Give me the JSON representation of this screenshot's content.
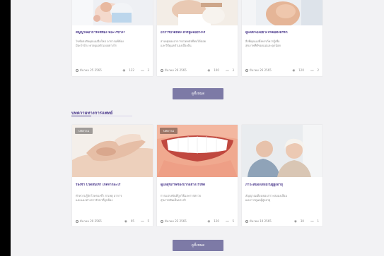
{
  "section": {
    "heading": "บทความทางการแพทย์"
  },
  "buttons": {
    "more_top": "ดูทั้งหมด",
    "more_bottom": "ดูทั้งหมด"
  },
  "top_cards": [
    {
      "title": "สัญญาณอาการแพ้ท้อง มีอะไรบ้าง?",
      "desc1": "ไขข้อสงสัยคุณแม่มือใหม่ อาการแพ้ท้อง",
      "desc2": "มีอะไรบ้าง ควรดูแลตัวเองอย่างไร",
      "date": "มีนาคม 25 2565",
      "views": "122",
      "comments": "3"
    },
    {
      "title": "อาการปวดหลัง ควรดูแลอย่างไร",
      "desc1": "สาเหตุของอาการปวดหลังที่พบได้บ่อย",
      "desc2": "และวิธีดูแลตัวเองเบื้องต้น",
      "date": "มีนาคม 26 2565",
      "views": "100",
      "comments": "3"
    },
    {
      "title": "ดูแลตัวเองอย่างไรเมื่อตั้งครรภ์",
      "desc1": "สิ่งที่คุณแม่ตั้งครรภ์ควรรู้เพื่อ",
      "desc2": "สุขภาพที่ดีของแม่และลูกน้อย",
      "date": "มีนาคม 26 2565",
      "views": "120",
      "comments": "2"
    }
  ],
  "bottom_cards": [
    {
      "tag": "บทความ",
      "title": "รองช้ำ ปวดส้นเท้า เกิดจากอะไร",
      "desc1": "ทำความรู้จักโรครองช้ำ สาเหตุ อาการ",
      "desc2": "และแนวทางการรักษาที่ถูกต้อง",
      "date": "มีนาคม 20 2565",
      "views": "95",
      "comments": "5"
    },
    {
      "tag": "บทความ",
      "title": "ดูแลสุขภาพช่องปากอย่างไรให้ดี",
      "desc1": "การแปรงฟันที่ถูกวิธีและการตรวจ",
      "desc2": "สุขภาพฟันเป็นประจำ",
      "date": "มีนาคม 22 2565",
      "views": "120",
      "comments": "5"
    },
    {
      "tag": "",
      "title": "ภาวะสมองเสื่อมในผู้สูงอายุ",
      "desc1": "สัญญาณเตือนของภาวะสมองเสื่อม",
      "desc2": "และการดูแลผู้สูงอายุ",
      "date": "มีนาคม 19 2565",
      "views": "30",
      "comments": "1"
    }
  ],
  "colors": {
    "title": "#4e3c8e",
    "button": "#7d7aa6",
    "background": "#f2f2f4"
  }
}
